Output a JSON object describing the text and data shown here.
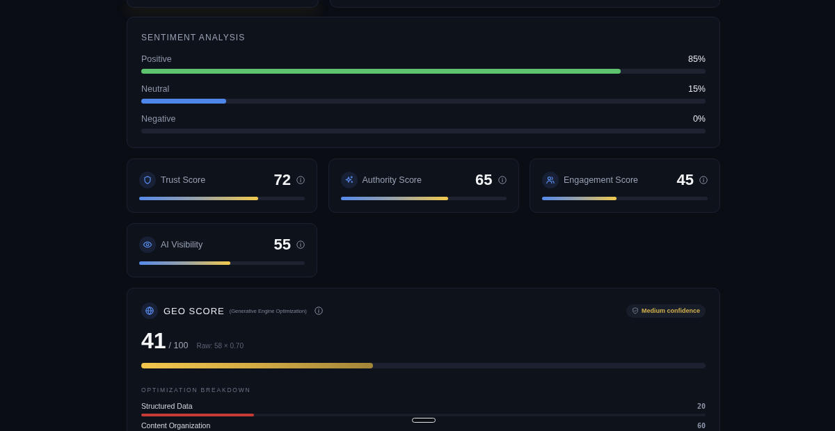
{
  "sentiment": {
    "title": "SENTIMENT ANALYSIS",
    "rows": [
      {
        "label": "Positive",
        "value": "85%",
        "level": 0.85,
        "color": "#5ec36e"
      },
      {
        "label": "Neutral",
        "value": "15%",
        "level": 0.15,
        "color": "#4f86ea"
      },
      {
        "label": "Negative",
        "value": "0%"
      }
    ]
  },
  "score_cards": [
    {
      "kind": "trust",
      "label": "Trust Score",
      "score": "72",
      "level": 0.72
    },
    {
      "kind": "authority",
      "label": "Authority Score",
      "score": "65",
      "level": 0.65
    },
    {
      "kind": "engagement",
      "label": "Engagement Score",
      "score": "45",
      "level": 0.45
    },
    {
      "kind": "visibility",
      "label": "AI Visibility",
      "score": "55",
      "level": 0.55
    }
  ],
  "geo": {
    "title": "GEO SCORE",
    "subtitle": "(Generative Engine Optimization)",
    "badge": "Medium confidence",
    "score": "41",
    "out_of": "/ 100",
    "raw": "Raw: 58 × 0.70",
    "level": 0.41,
    "breakdown_title": "OPTIMIZATION BREAKDOWN",
    "breakdown": [
      {
        "label": "Structured Data",
        "value": "20",
        "level": 0.2,
        "color": "#c83a36"
      },
      {
        "label": "Content Organization",
        "value": "60"
      }
    ]
  }
}
